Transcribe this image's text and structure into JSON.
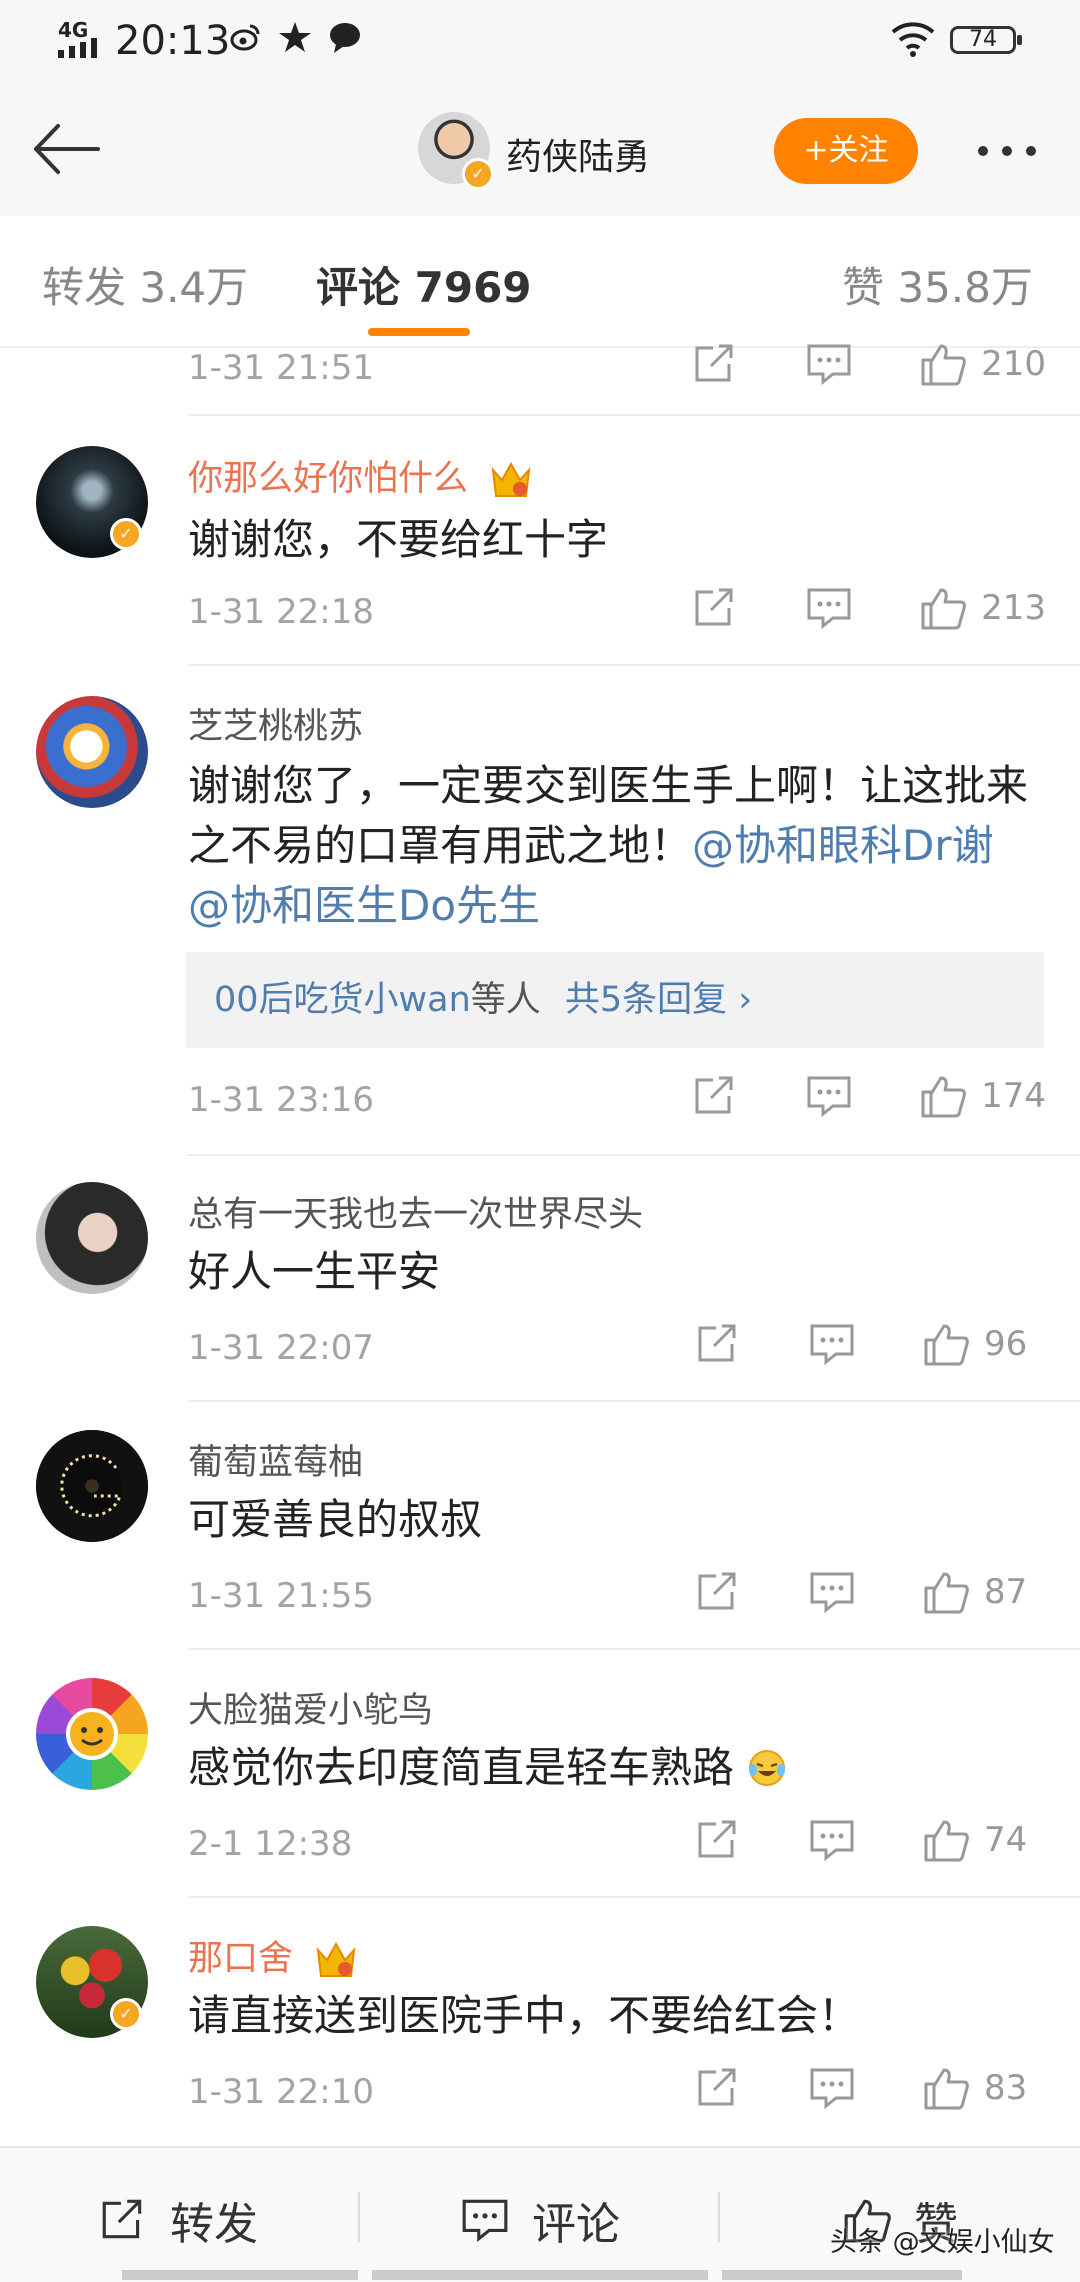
{
  "status_bar": {
    "network": "4G",
    "time": "20:13",
    "battery": "74"
  },
  "nav": {
    "title": "药侠陆勇",
    "follow_label": "+关注"
  },
  "tabs": {
    "repost": "转发 3.4万",
    "comments": "评论 7969",
    "likes": "赞 35.8万"
  },
  "colors": {
    "accent": "#ff8200",
    "link": "#507daf",
    "vip_name": "#eb7350"
  },
  "comments": [
    {
      "time": "1-31 21:51",
      "likes": "210"
    },
    {
      "user": "你那么好你怕什么",
      "text": "谢谢您，不要给红十字",
      "time": "1-31 22:18",
      "likes": "213"
    },
    {
      "user": "芝芝桃桃苏",
      "text_part1": "谢谢您了，一定要交到医生手上啊！让这批来之不易的口罩有用武之地！",
      "mention1": "@协和眼科Dr谢",
      "mention2": "@协和医生Do先生",
      "reply_user": "00后吃货小wan",
      "reply_mid": "等人",
      "reply_count": "共5条回复 ›",
      "time": "1-31 23:16",
      "likes": "174"
    },
    {
      "user": "总有一天我也去一次世界尽头",
      "text": "好人一生平安",
      "time": "1-31 22:07",
      "likes": "96"
    },
    {
      "user": "葡萄蓝莓柚",
      "text": "可爱善良的叔叔",
      "time": "1-31 21:55",
      "likes": "87"
    },
    {
      "user": "大脸猫爱小鸵鸟",
      "text": "感觉你去印度简直是轻车熟路",
      "time": "2-1 12:38",
      "likes": "74"
    },
    {
      "user": "那口舍",
      "text": "请直接送到医院手中，不要给红会！",
      "time": "1-31 22:10",
      "likes": "83"
    }
  ],
  "bottom_bar": {
    "repost": "转发",
    "comment": "评论",
    "like": "赞"
  },
  "watermark": "头条 @文娱小仙女"
}
